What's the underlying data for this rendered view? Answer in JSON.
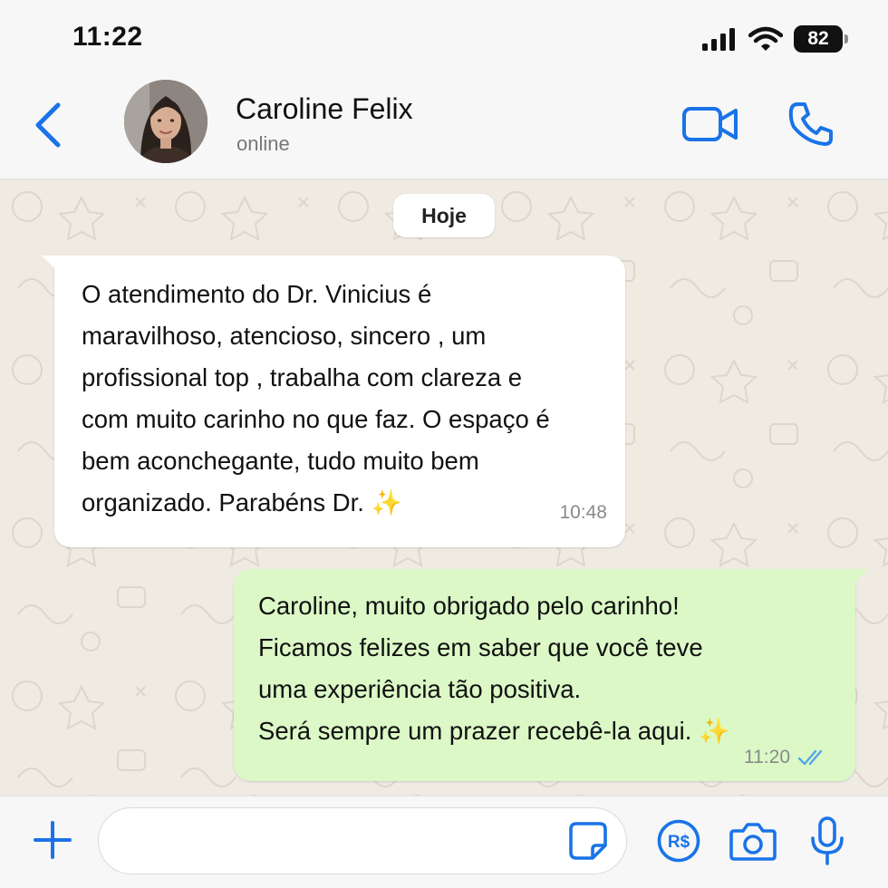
{
  "status_bar": {
    "time": "11:22",
    "battery": "82",
    "icons": [
      "signal-icon",
      "wifi-icon",
      "battery-icon"
    ]
  },
  "header": {
    "contact_name": "Caroline Felix",
    "contact_status": "online",
    "icons": [
      "back-icon",
      "video-call-icon",
      "phone-icon"
    ]
  },
  "chat": {
    "date_label": "Hoje",
    "messages": [
      {
        "direction": "incoming",
        "text": "O atendimento do Dr. Vinicius é\nmaravilhoso, atencioso, sincero , um\nprofissional top , trabalha com clareza e\ncom muito carinho no que faz. O espaço é\nbem aconchegante, tudo muito bem\norganizado. Parabéns Dr. ✨",
        "time": "10:48"
      },
      {
        "direction": "outgoing",
        "text": "Caroline, muito obrigado pelo carinho!\nFicamos felizes em saber que você teve\numa experiência tão positiva.\nSerá sempre um prazer recebê-la aqui. ✨",
        "time": "11:20",
        "read_status": "read"
      }
    ]
  },
  "input_bar": {
    "message_value": "",
    "icons": [
      "plus-icon",
      "sticker-icon",
      "payment-icon",
      "camera-icon",
      "microphone-icon"
    ],
    "pay_label": "R$"
  },
  "colors": {
    "accent": "#1a73e8",
    "chat_background": "#efeae2",
    "incoming_bubble": "#ffffff",
    "outgoing_bubble": "#dbf8c6",
    "read_ticks": "#53a6e8"
  }
}
